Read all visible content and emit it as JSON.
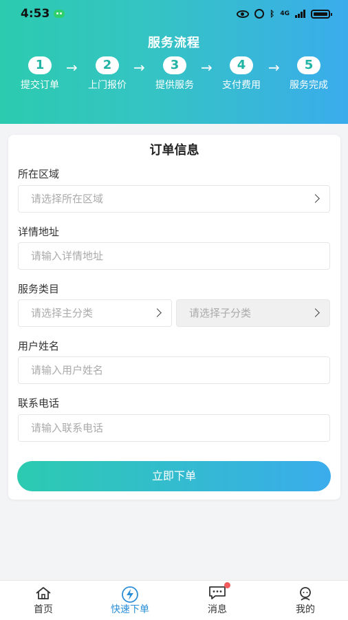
{
  "status_bar": {
    "time": "4:53",
    "network": "4G"
  },
  "header": {
    "title": "服务流程",
    "steps": [
      {
        "num": "1",
        "label": "提交订单"
      },
      {
        "num": "2",
        "label": "上门报价"
      },
      {
        "num": "3",
        "label": "提供服务"
      },
      {
        "num": "4",
        "label": "支付费用"
      },
      {
        "num": "5",
        "label": "服务完成"
      }
    ],
    "arrow": "→"
  },
  "form": {
    "title": "订单信息",
    "region": {
      "label": "所在区域",
      "placeholder": "请选择所在区域"
    },
    "address": {
      "label": "详情地址",
      "placeholder": "请输入详情地址"
    },
    "category": {
      "label": "服务类目",
      "main_placeholder": "请选择主分类",
      "sub_placeholder": "请选择子分类"
    },
    "name": {
      "label": "用户姓名",
      "placeholder": "请输入用户姓名"
    },
    "phone": {
      "label": "联系电话",
      "placeholder": "请输入联系电话"
    },
    "submit_label": "立即下单"
  },
  "tabbar": {
    "items": [
      {
        "label": "首页",
        "icon": "home-icon"
      },
      {
        "label": "快速下单",
        "icon": "lightning-icon",
        "active": true
      },
      {
        "label": "消息",
        "icon": "message-icon",
        "badge": true
      },
      {
        "label": "我的",
        "icon": "profile-icon"
      }
    ]
  },
  "colors": {
    "gradient_start": "#2ccbb0",
    "gradient_end": "#3aacec",
    "active_tab": "#2a8fd8",
    "badge": "#f05a5a"
  }
}
